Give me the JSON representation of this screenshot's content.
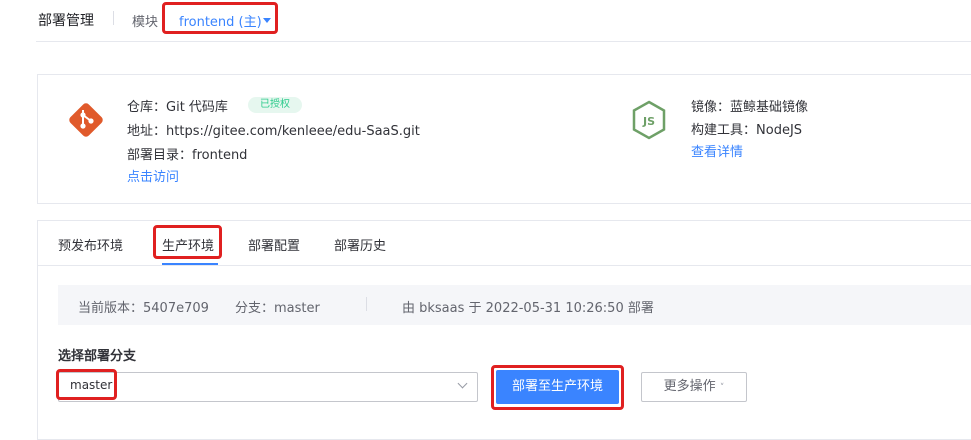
{
  "header": {
    "title": "部署管理",
    "module_label": "模块",
    "module_value": "frontend (主)"
  },
  "repo": {
    "repo_label": "仓库：",
    "repo_value": "Git 代码库",
    "auth_badge": "已授权",
    "address_label": "地址：",
    "address_value": "https://gitee.com/kenleee/edu-SaaS.git",
    "dir_label": "部署目录：",
    "dir_value": "frontend",
    "visit_link": "点击访问"
  },
  "image": {
    "image_label": "镜像：",
    "image_value": "蓝鲸基础镜像",
    "build_label": "构建工具：",
    "build_value": "NodeJS",
    "details_link": "查看详情"
  },
  "tabs": [
    {
      "label": "预发布环境",
      "active": false
    },
    {
      "label": "生产环境",
      "active": true
    },
    {
      "label": "部署配置",
      "active": false
    },
    {
      "label": "部署历史",
      "active": false
    }
  ],
  "status": {
    "version_label": "当前版本：",
    "version_value": "5407e709",
    "branch_label": "分支：",
    "branch_value": "master",
    "deployed_info": "由 bksaas 于 2022-05-31 10:26:50 部署"
  },
  "deploy": {
    "section_label": "选择部署分支",
    "branch_selected": "master",
    "deploy_button": "部署至生产环境",
    "more_button": "更多操作"
  },
  "colors": {
    "accent": "#3a84ff",
    "highlight_border": "#e02020",
    "badge_bg": "#e6f7ef",
    "badge_text": "#2dcb8c",
    "git_logo": "#e05a2b",
    "node_logo": "#6ea067"
  },
  "icons": {
    "git": "git-logo-icon",
    "nodejs": "nodejs-logo-icon",
    "module_caret": "caret-down-icon",
    "branch_chevron": "chevron-down-icon",
    "more_chevron": "chevron-down-small-icon"
  }
}
